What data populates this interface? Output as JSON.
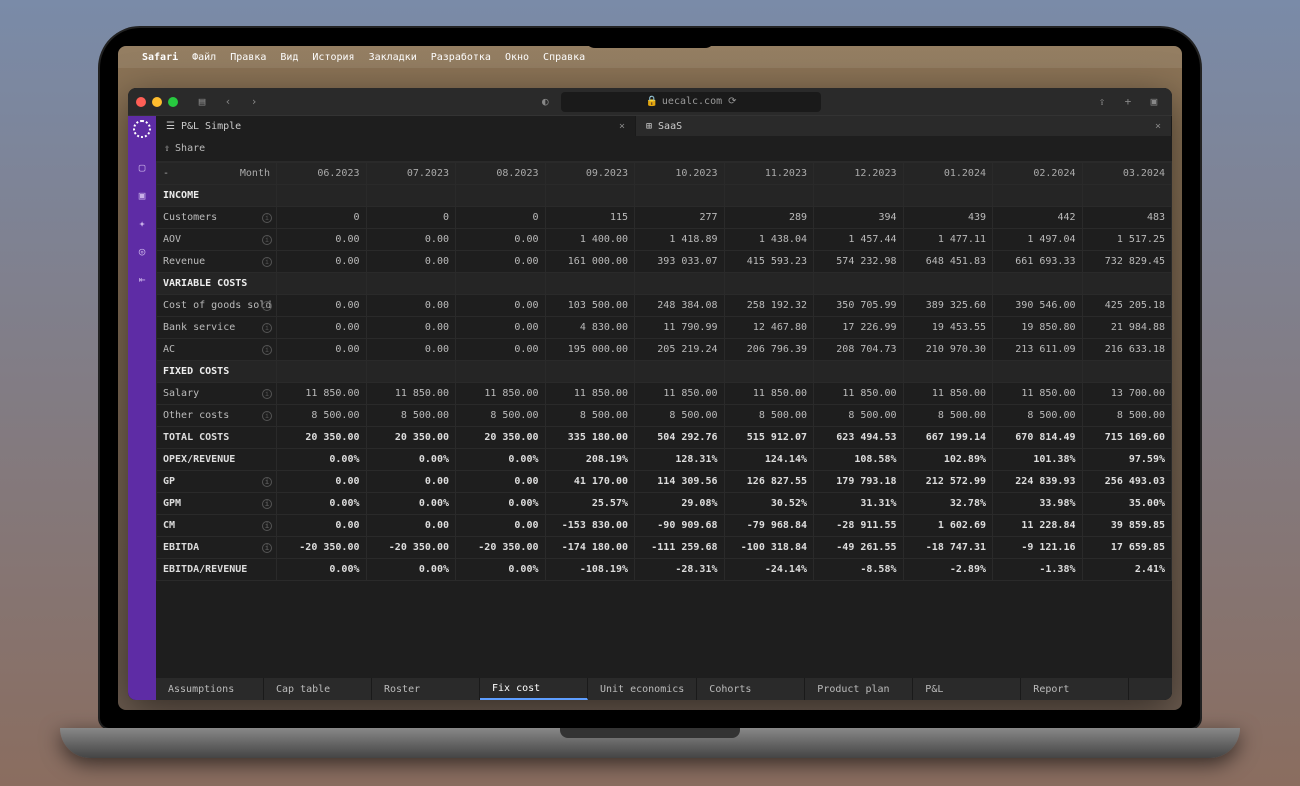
{
  "menubar": {
    "app": "Safari",
    "items": [
      "Файл",
      "Правка",
      "Вид",
      "История",
      "Закладки",
      "Разработка",
      "Окно",
      "Справка"
    ]
  },
  "browser": {
    "url": "uecalc.com"
  },
  "tabs": [
    {
      "icon": "pl",
      "label": "P&L Simple",
      "active": true
    },
    {
      "icon": "grid",
      "label": "SaaS",
      "active": false
    }
  ],
  "share_label": "Share",
  "table": {
    "header_first": "Month",
    "header_dash": "-",
    "months": [
      "06.2023",
      "07.2023",
      "08.2023",
      "09.2023",
      "10.2023",
      "11.2023",
      "12.2023",
      "01.2024",
      "02.2024",
      "03.2024"
    ],
    "sections": [
      {
        "title": "INCOME",
        "rows": [
          {
            "label": "Customers",
            "info": true,
            "values": [
              "0",
              "0",
              "0",
              "115",
              "277",
              "289",
              "394",
              "439",
              "442",
              "483"
            ]
          },
          {
            "label": "AOV",
            "info": true,
            "values": [
              "0.00",
              "0.00",
              "0.00",
              "1 400.00",
              "1 418.89",
              "1 438.04",
              "1 457.44",
              "1 477.11",
              "1 497.04",
              "1 517.25"
            ]
          },
          {
            "label": "Revenue",
            "info": true,
            "values": [
              "0.00",
              "0.00",
              "0.00",
              "161 000.00",
              "393 033.07",
              "415 593.23",
              "574 232.98",
              "648 451.83",
              "661 693.33",
              "732 829.45"
            ]
          }
        ]
      },
      {
        "title": "VARIABLE COSTS",
        "rows": [
          {
            "label": "Cost of goods sold",
            "info": true,
            "values": [
              "0.00",
              "0.00",
              "0.00",
              "103 500.00",
              "248 384.08",
              "258 192.32",
              "350 705.99",
              "389 325.60",
              "390 546.00",
              "425 205.18"
            ]
          },
          {
            "label": "Bank service",
            "info": true,
            "values": [
              "0.00",
              "0.00",
              "0.00",
              "4 830.00",
              "11 790.99",
              "12 467.80",
              "17 226.99",
              "19 453.55",
              "19 850.80",
              "21 984.88"
            ]
          },
          {
            "label": "AC",
            "info": true,
            "values": [
              "0.00",
              "0.00",
              "0.00",
              "195 000.00",
              "205 219.24",
              "206 796.39",
              "208 704.73",
              "210 970.30",
              "213 611.09",
              "216 633.18"
            ]
          }
        ]
      },
      {
        "title": "FIXED COSTS",
        "rows": [
          {
            "label": "Salary",
            "info": true,
            "values": [
              "11 850.00",
              "11 850.00",
              "11 850.00",
              "11 850.00",
              "11 850.00",
              "11 850.00",
              "11 850.00",
              "11 850.00",
              "11 850.00",
              "13 700.00"
            ]
          },
          {
            "label": "Other costs",
            "info": true,
            "values": [
              "8 500.00",
              "8 500.00",
              "8 500.00",
              "8 500.00",
              "8 500.00",
              "8 500.00",
              "8 500.00",
              "8 500.00",
              "8 500.00",
              "8 500.00"
            ]
          },
          {
            "label": "TOTAL COSTS",
            "info": false,
            "bold": true,
            "values": [
              "20 350.00",
              "20 350.00",
              "20 350.00",
              "335 180.00",
              "504 292.76",
              "515 912.07",
              "623 494.53",
              "667 199.14",
              "670 814.49",
              "715 169.60"
            ]
          },
          {
            "label": "OPEX/REVENUE",
            "info": false,
            "bold": true,
            "values": [
              "0.00%",
              "0.00%",
              "0.00%",
              "208.19%",
              "128.31%",
              "124.14%",
              "108.58%",
              "102.89%",
              "101.38%",
              "97.59%"
            ]
          },
          {
            "label": "GP",
            "info": true,
            "bold": true,
            "values": [
              "0.00",
              "0.00",
              "0.00",
              "41 170.00",
              "114 309.56",
              "126 827.55",
              "179 793.18",
              "212 572.99",
              "224 839.93",
              "256 493.03"
            ]
          },
          {
            "label": "GPM",
            "info": true,
            "bold": true,
            "values": [
              "0.00%",
              "0.00%",
              "0.00%",
              "25.57%",
              "29.08%",
              "30.52%",
              "31.31%",
              "32.78%",
              "33.98%",
              "35.00%"
            ]
          },
          {
            "label": "CM",
            "info": true,
            "bold": true,
            "values": [
              "0.00",
              "0.00",
              "0.00",
              "-153 830.00",
              "-90 909.68",
              "-79 968.84",
              "-28 911.55",
              "1 602.69",
              "11 228.84",
              "39 859.85"
            ]
          },
          {
            "label": "EBITDA",
            "info": true,
            "bold": true,
            "values": [
              "-20 350.00",
              "-20 350.00",
              "-20 350.00",
              "-174 180.00",
              "-111 259.68",
              "-100 318.84",
              "-49 261.55",
              "-18 747.31",
              "-9 121.16",
              "17 659.85"
            ]
          },
          {
            "label": "EBITDA/REVENUE",
            "info": false,
            "bold": true,
            "values": [
              "0.00%",
              "0.00%",
              "0.00%",
              "-108.19%",
              "-28.31%",
              "-24.14%",
              "-8.58%",
              "-2.89%",
              "-1.38%",
              "2.41%"
            ]
          }
        ]
      }
    ]
  },
  "bottom_tabs": [
    {
      "label": "Assumptions",
      "active": false
    },
    {
      "label": "Cap table",
      "active": false
    },
    {
      "label": "Roster",
      "active": false
    },
    {
      "label": "Fix cost",
      "active": true
    },
    {
      "label": "Unit economics",
      "active": false
    },
    {
      "label": "Cohorts",
      "active": false
    },
    {
      "label": "Product plan",
      "active": false
    },
    {
      "label": "P&L",
      "active": false
    },
    {
      "label": "Report",
      "active": false
    }
  ]
}
